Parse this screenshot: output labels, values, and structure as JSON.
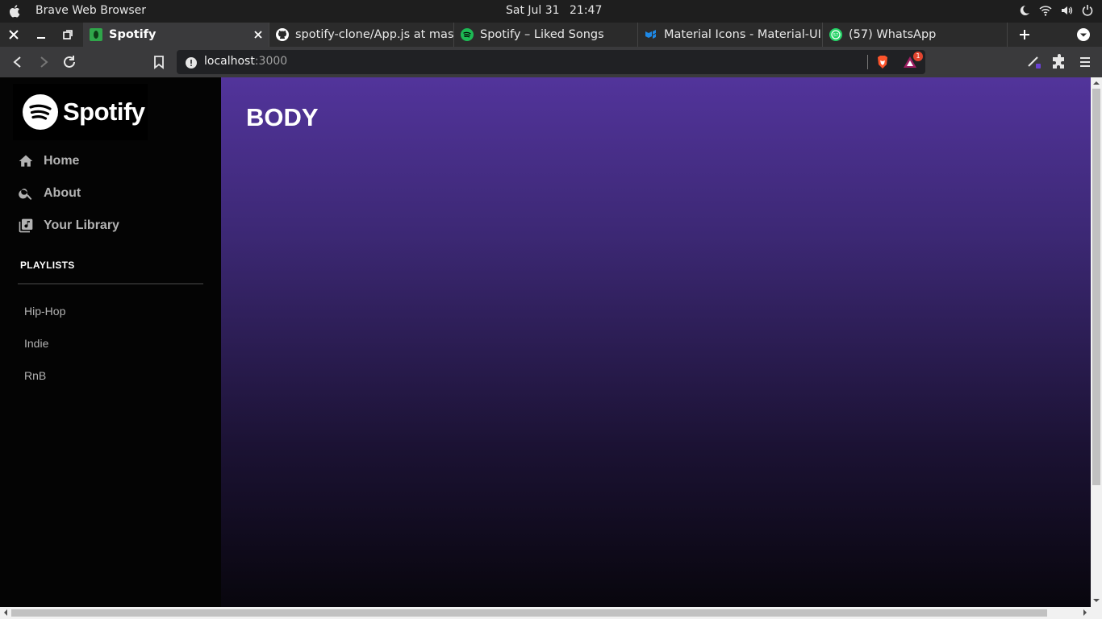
{
  "os": {
    "app_title": "Brave Web Browser",
    "date": "Sat Jul 31",
    "time": "21:47"
  },
  "tabs": [
    {
      "title": "Spotify",
      "icon": "spotify-green-icon",
      "active": true
    },
    {
      "title": "spotify-clone/App.js at mast",
      "icon": "github-icon",
      "active": false
    },
    {
      "title": "Spotify – Liked Songs",
      "icon": "spotify-icon",
      "active": false
    },
    {
      "title": "Material Icons - Material-UI",
      "icon": "material-ui-icon",
      "active": false
    },
    {
      "title": "(57) WhatsApp",
      "icon": "whatsapp-icon",
      "active": false
    }
  ],
  "address_bar": {
    "host": "localhost",
    "port": ":3000",
    "rewards_badge": "1"
  },
  "sidebar": {
    "logo_text": "Spotify",
    "nav": [
      {
        "label": "Home",
        "icon": "home-icon"
      },
      {
        "label": "About",
        "icon": "search-icon"
      },
      {
        "label": "Your Library",
        "icon": "library-music-icon"
      }
    ],
    "playlists_title": "PLAYLISTS",
    "playlists": [
      "Hip-Hop",
      "Indie",
      "RnB"
    ]
  },
  "body": {
    "heading": "BODY"
  },
  "colors": {
    "body_gradient_top": "#52349b",
    "body_gradient_bottom": "#08060d",
    "sidebar_bg": "#040404",
    "nav_text": "#b3b3b3",
    "spotify_green": "#1db954"
  }
}
